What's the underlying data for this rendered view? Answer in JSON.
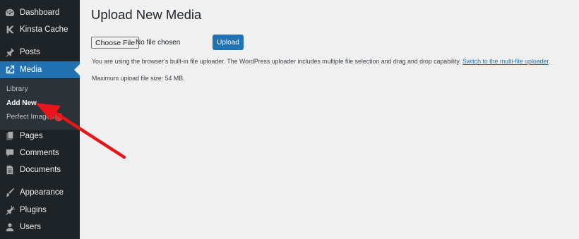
{
  "sidebar": {
    "items": [
      {
        "label": "Dashboard",
        "icon": "dashboard-icon"
      },
      {
        "label": "Kinsta Cache",
        "icon": "kinsta-icon"
      },
      {
        "label": "Posts",
        "icon": "pin-icon"
      },
      {
        "label": "Media",
        "icon": "media-icon",
        "active": true
      },
      {
        "label": "Pages",
        "icon": "pages-icon"
      },
      {
        "label": "Comments",
        "icon": "comments-icon"
      },
      {
        "label": "Documents",
        "icon": "documents-icon"
      },
      {
        "label": "Appearance",
        "icon": "brush-icon"
      },
      {
        "label": "Plugins",
        "icon": "plug-icon"
      },
      {
        "label": "Users",
        "icon": "users-icon"
      }
    ],
    "submenu": [
      {
        "label": "Library"
      },
      {
        "label": "Add New",
        "current": true
      },
      {
        "label": "Perfect Images"
      }
    ]
  },
  "main": {
    "title": "Upload New Media",
    "choose_file_label": "Choose File",
    "file_status": "No file chosen",
    "upload_label": "Upload",
    "help_text": "You are using the browser’s built-in file uploader. The WordPress uploader includes multiple file selection and drag and drop capability.",
    "help_link": "Switch to the multi-file uploader",
    "help_end": ".",
    "max_size": "Maximum upload file size: 54 MB."
  },
  "colors": {
    "sidebar_bg": "#1d2327",
    "active_bg": "#2271b1",
    "content_bg": "#f0f0f1",
    "annotation_arrow": "#e8151b"
  }
}
